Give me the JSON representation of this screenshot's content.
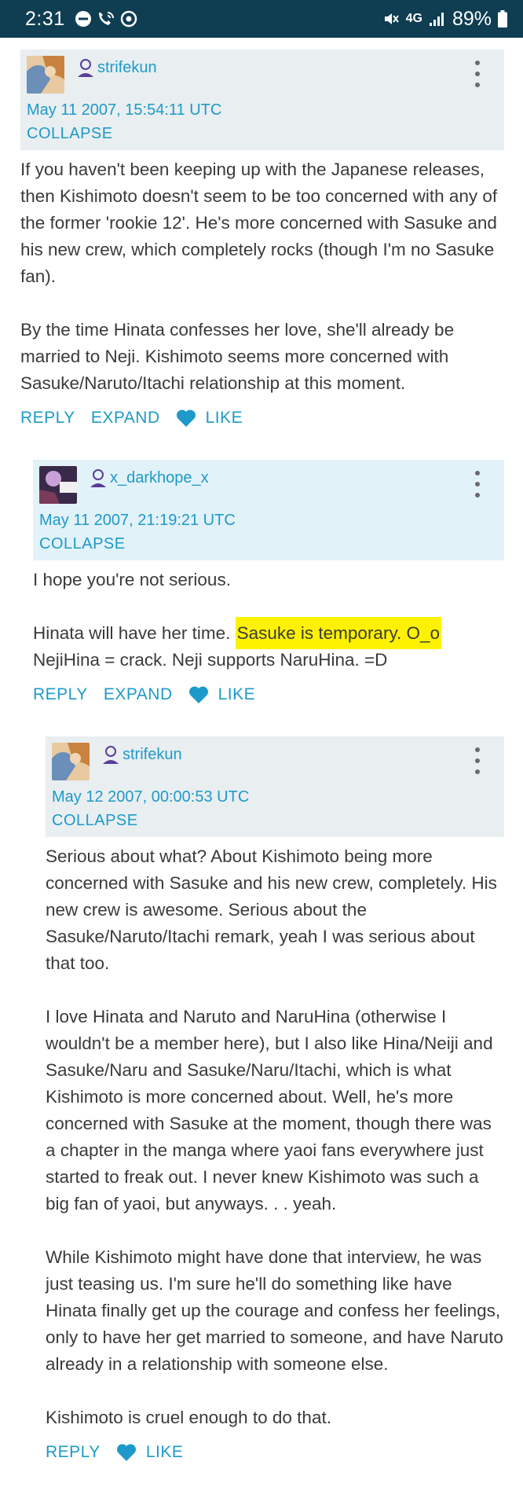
{
  "status_bar": {
    "time": "2:31",
    "network": "4G",
    "battery": "89%"
  },
  "comments": [
    {
      "username": "strifekun",
      "timestamp": "May 11 2007, 15:54:11 UTC",
      "collapse": "COLLAPSE",
      "paragraphs": [
        "If you haven't been keeping up with the Japanese releases, then Kishimoto doesn't seem to be too concerned with any of the former 'rookie 12'. He's more concerned with Sasuke and his new crew, which completely rocks (though I'm no Sasuke fan).",
        "By the time Hinata confesses her love, she'll already be married to Neji. Kishimoto seems more concerned with Sasuke/Naruto/Itachi relationship at this moment."
      ],
      "actions": {
        "reply": "REPLY",
        "expand": "EXPAND",
        "like": "LIKE"
      }
    },
    {
      "username": "x_darkhope_x",
      "timestamp": "May 11 2007, 21:19:21 UTC",
      "collapse": "COLLAPSE",
      "p1": "I hope you're not serious.",
      "p2_before": "Hinata will have her time. ",
      "p2_highlight": "Sasuke is temporary. O_o",
      "p2_after": "NejiHina = crack. Neji supports NaruHina. =D",
      "actions": {
        "reply": "REPLY",
        "expand": "EXPAND",
        "like": "LIKE"
      }
    },
    {
      "username": "strifekun",
      "timestamp": "May 12 2007, 00:00:53 UTC",
      "collapse": "COLLAPSE",
      "paragraphs": [
        "Serious about what? About Kishimoto being more concerned with Sasuke and his new crew, completely. His new crew is awesome. Serious about the Sasuke/Naruto/Itachi remark, yeah I was serious about that too.",
        "I love Hinata and Naruto and NaruHina (otherwise I wouldn't be a member here), but I also like Hina/Neiji and Sasuke/Naru and Sasuke/Naru/Itachi, which is what Kishimoto is more concerned about. Well, he's more concerned with Sasuke at the moment, though there was a chapter in the manga where yaoi fans everywhere just started to freak out. I never knew Kishimoto was such a big fan of yaoi, but anyways. . . yeah.",
        "While Kishimoto might have done that interview, he was just teasing us. I'm sure he'll do something like have Hinata finally get up the courage and confess her feelings, only to have her get married to someone, and have Naruto already in a relationship with someone else.",
        "Kishimoto is cruel enough to do that."
      ],
      "actions": {
        "reply": "REPLY",
        "like": "LIKE"
      }
    }
  ],
  "colors": {
    "status_bar": "#0f3e52",
    "link": "#1d9ac9",
    "header_gray": "#e9eef0",
    "header_blue": "#e2f2f9",
    "highlight": "#fef200",
    "text": "#3a3a3a"
  }
}
